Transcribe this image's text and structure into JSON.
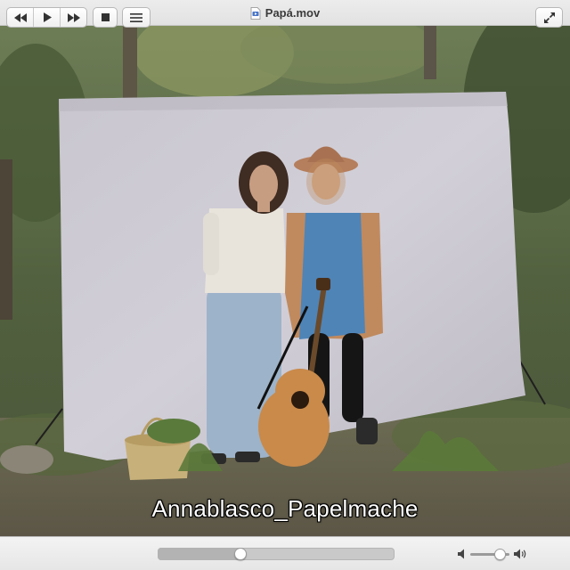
{
  "window": {
    "title": "Papá.mov",
    "title_icon": "movie-file-icon"
  },
  "video": {
    "subtitle": "Annablasco_Papelmache"
  },
  "controls": {
    "rewind_icon": "rewind-icon",
    "play_icon": "play-icon",
    "fast_forward_icon": "fast-forward-icon",
    "stop_icon": "stop-icon",
    "playlist_icon": "playlist-icon",
    "volume_low_icon": "volume-low-icon",
    "volume_high_icon": "volume-high-icon",
    "fullscreen_icon": "fullscreen-icon",
    "playback_progress": 0.34,
    "volume_level": 0.75
  },
  "colors": {
    "close": "#fe5f57",
    "minimize": "#febc2e",
    "maximize": "#28c840"
  }
}
